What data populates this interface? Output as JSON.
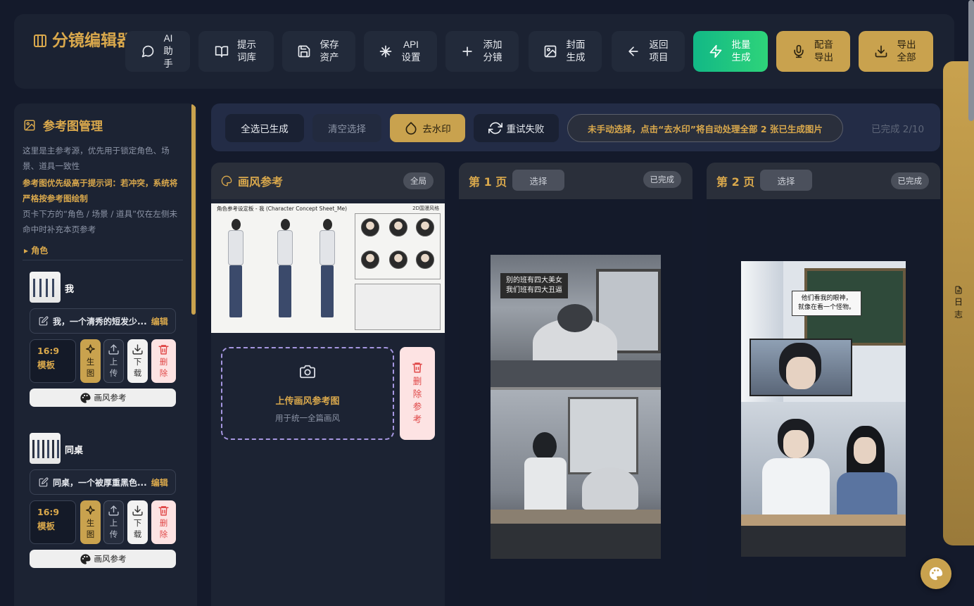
{
  "app": {
    "title": "分镜编辑器"
  },
  "toolbar": [
    {
      "label": "AI助手",
      "icon": "chat-icon"
    },
    {
      "label": "提示词库",
      "icon": "book-icon"
    },
    {
      "label": "保存资产",
      "icon": "save-icon"
    },
    {
      "label": "API设置",
      "icon": "sparkle-icon"
    },
    {
      "label": "添加分镜",
      "icon": "plus-icon"
    },
    {
      "label": "封面生成",
      "icon": "image-icon"
    },
    {
      "label": "返回项目",
      "icon": "arrow-left-icon"
    },
    {
      "label": "批量生成",
      "icon": "bolt-icon"
    },
    {
      "label": "配音导出",
      "icon": "mic-icon"
    },
    {
      "label": "导出全部",
      "icon": "download-icon"
    }
  ],
  "sidebar": {
    "title": "参考图管理",
    "desc1": "这里是主参考源，优先用于锁定角色、场景、道具一致性",
    "desc2": "参考图优先级高于提示词：若冲突，系统将严格按参考图绘制",
    "desc3": "页卡下方的“角色 / 场景 / 道具”仅在左侧未命中时补充本页参考",
    "section": "▸ 角色",
    "characters": [
      {
        "name": "我",
        "desc": "我，一个清秀的短发少...",
        "edit": "编辑",
        "ratio": "16:9 模板",
        "gen": "生图",
        "upload": "上传",
        "download": "下载",
        "delete": "删除",
        "style": "画风参考"
      },
      {
        "name": "同桌",
        "desc": "同桌，一个被厚重黑色...",
        "edit": "编辑",
        "ratio": "16:9 模板",
        "gen": "生图",
        "upload": "上传",
        "download": "下载",
        "delete": "删除",
        "style": "画风参考"
      }
    ]
  },
  "actions": {
    "select_all": "全选已生成",
    "clear": "清空选择",
    "watermark": "去水印",
    "retry": "重试失败",
    "hint": "未手动选择，点击“去水印”将自动处理全部 2 张已生成图片",
    "progress": "已完成 2/10"
  },
  "style_column": {
    "title": "画风参考",
    "badge": "全局",
    "sheet_title": "角色参考设定板 - 我 (Character Concept Sheet_Me)",
    "sheet_tag": "2D国漫风格",
    "upload_title": "上传画风参考图",
    "upload_sub": "用于统一全篇画风",
    "delete_label": "删除参考"
  },
  "pages": [
    {
      "title": "第 1 页",
      "select": "选择",
      "status": "已完成",
      "bubble1": "别的班有四大美女",
      "bubble2": "我们班有四大丑逼"
    },
    {
      "title": "第 2 页",
      "select": "选择",
      "status": "已完成",
      "bubble1": "他们看我的眼神，",
      "bubble2": "就像在看一个怪物。"
    }
  ],
  "log": {
    "label": "日志"
  },
  "colors": {
    "accent": "#c9a24e",
    "green": "#12b886",
    "danger": "#e04848",
    "bg": "#141a2b"
  }
}
